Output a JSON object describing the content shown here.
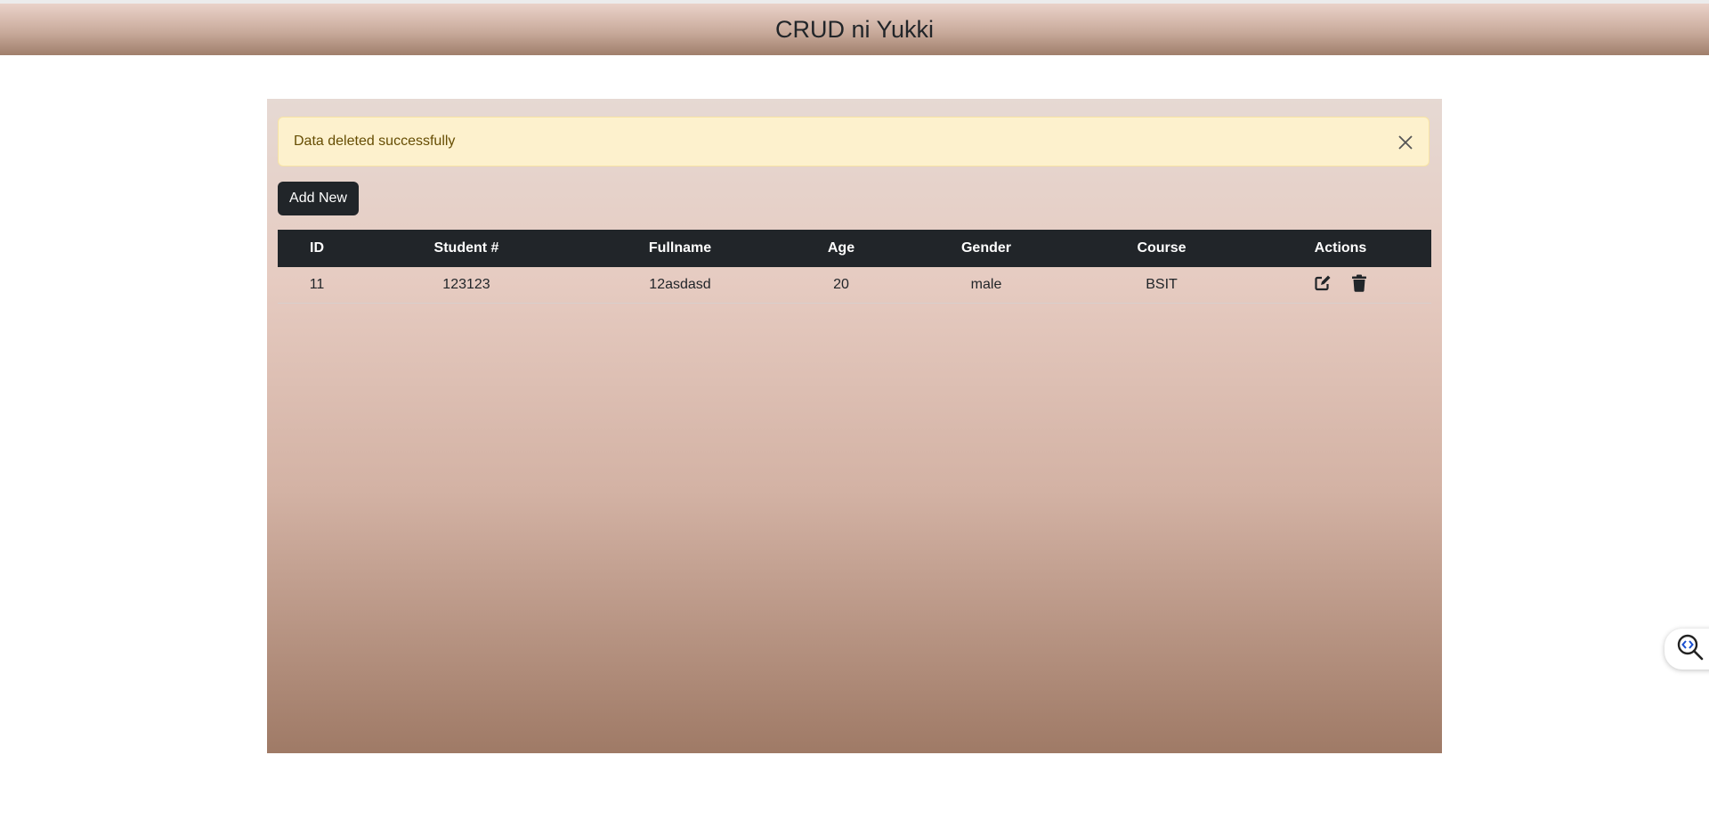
{
  "header": {
    "title": "CRUD ni Yukki"
  },
  "alert": {
    "message": "Data deleted successfully",
    "close_icon": "close-icon"
  },
  "toolbar": {
    "add_new_label": "Add New"
  },
  "table": {
    "columns": [
      "ID",
      "Student #",
      "Fullname",
      "Age",
      "Gender",
      "Course",
      "Actions"
    ],
    "rows": [
      {
        "id": "11",
        "student_no": "123123",
        "fullname": "12asdasd",
        "age": "20",
        "gender": "male",
        "course": "BSIT",
        "actions": [
          "edit-icon",
          "trash-icon"
        ]
      }
    ]
  },
  "floating_widget": {
    "icon": "code-search-icon"
  },
  "colors": {
    "header_dark": "#212529",
    "alert_bg": "#fdf1cd",
    "alert_text": "#664d03"
  }
}
